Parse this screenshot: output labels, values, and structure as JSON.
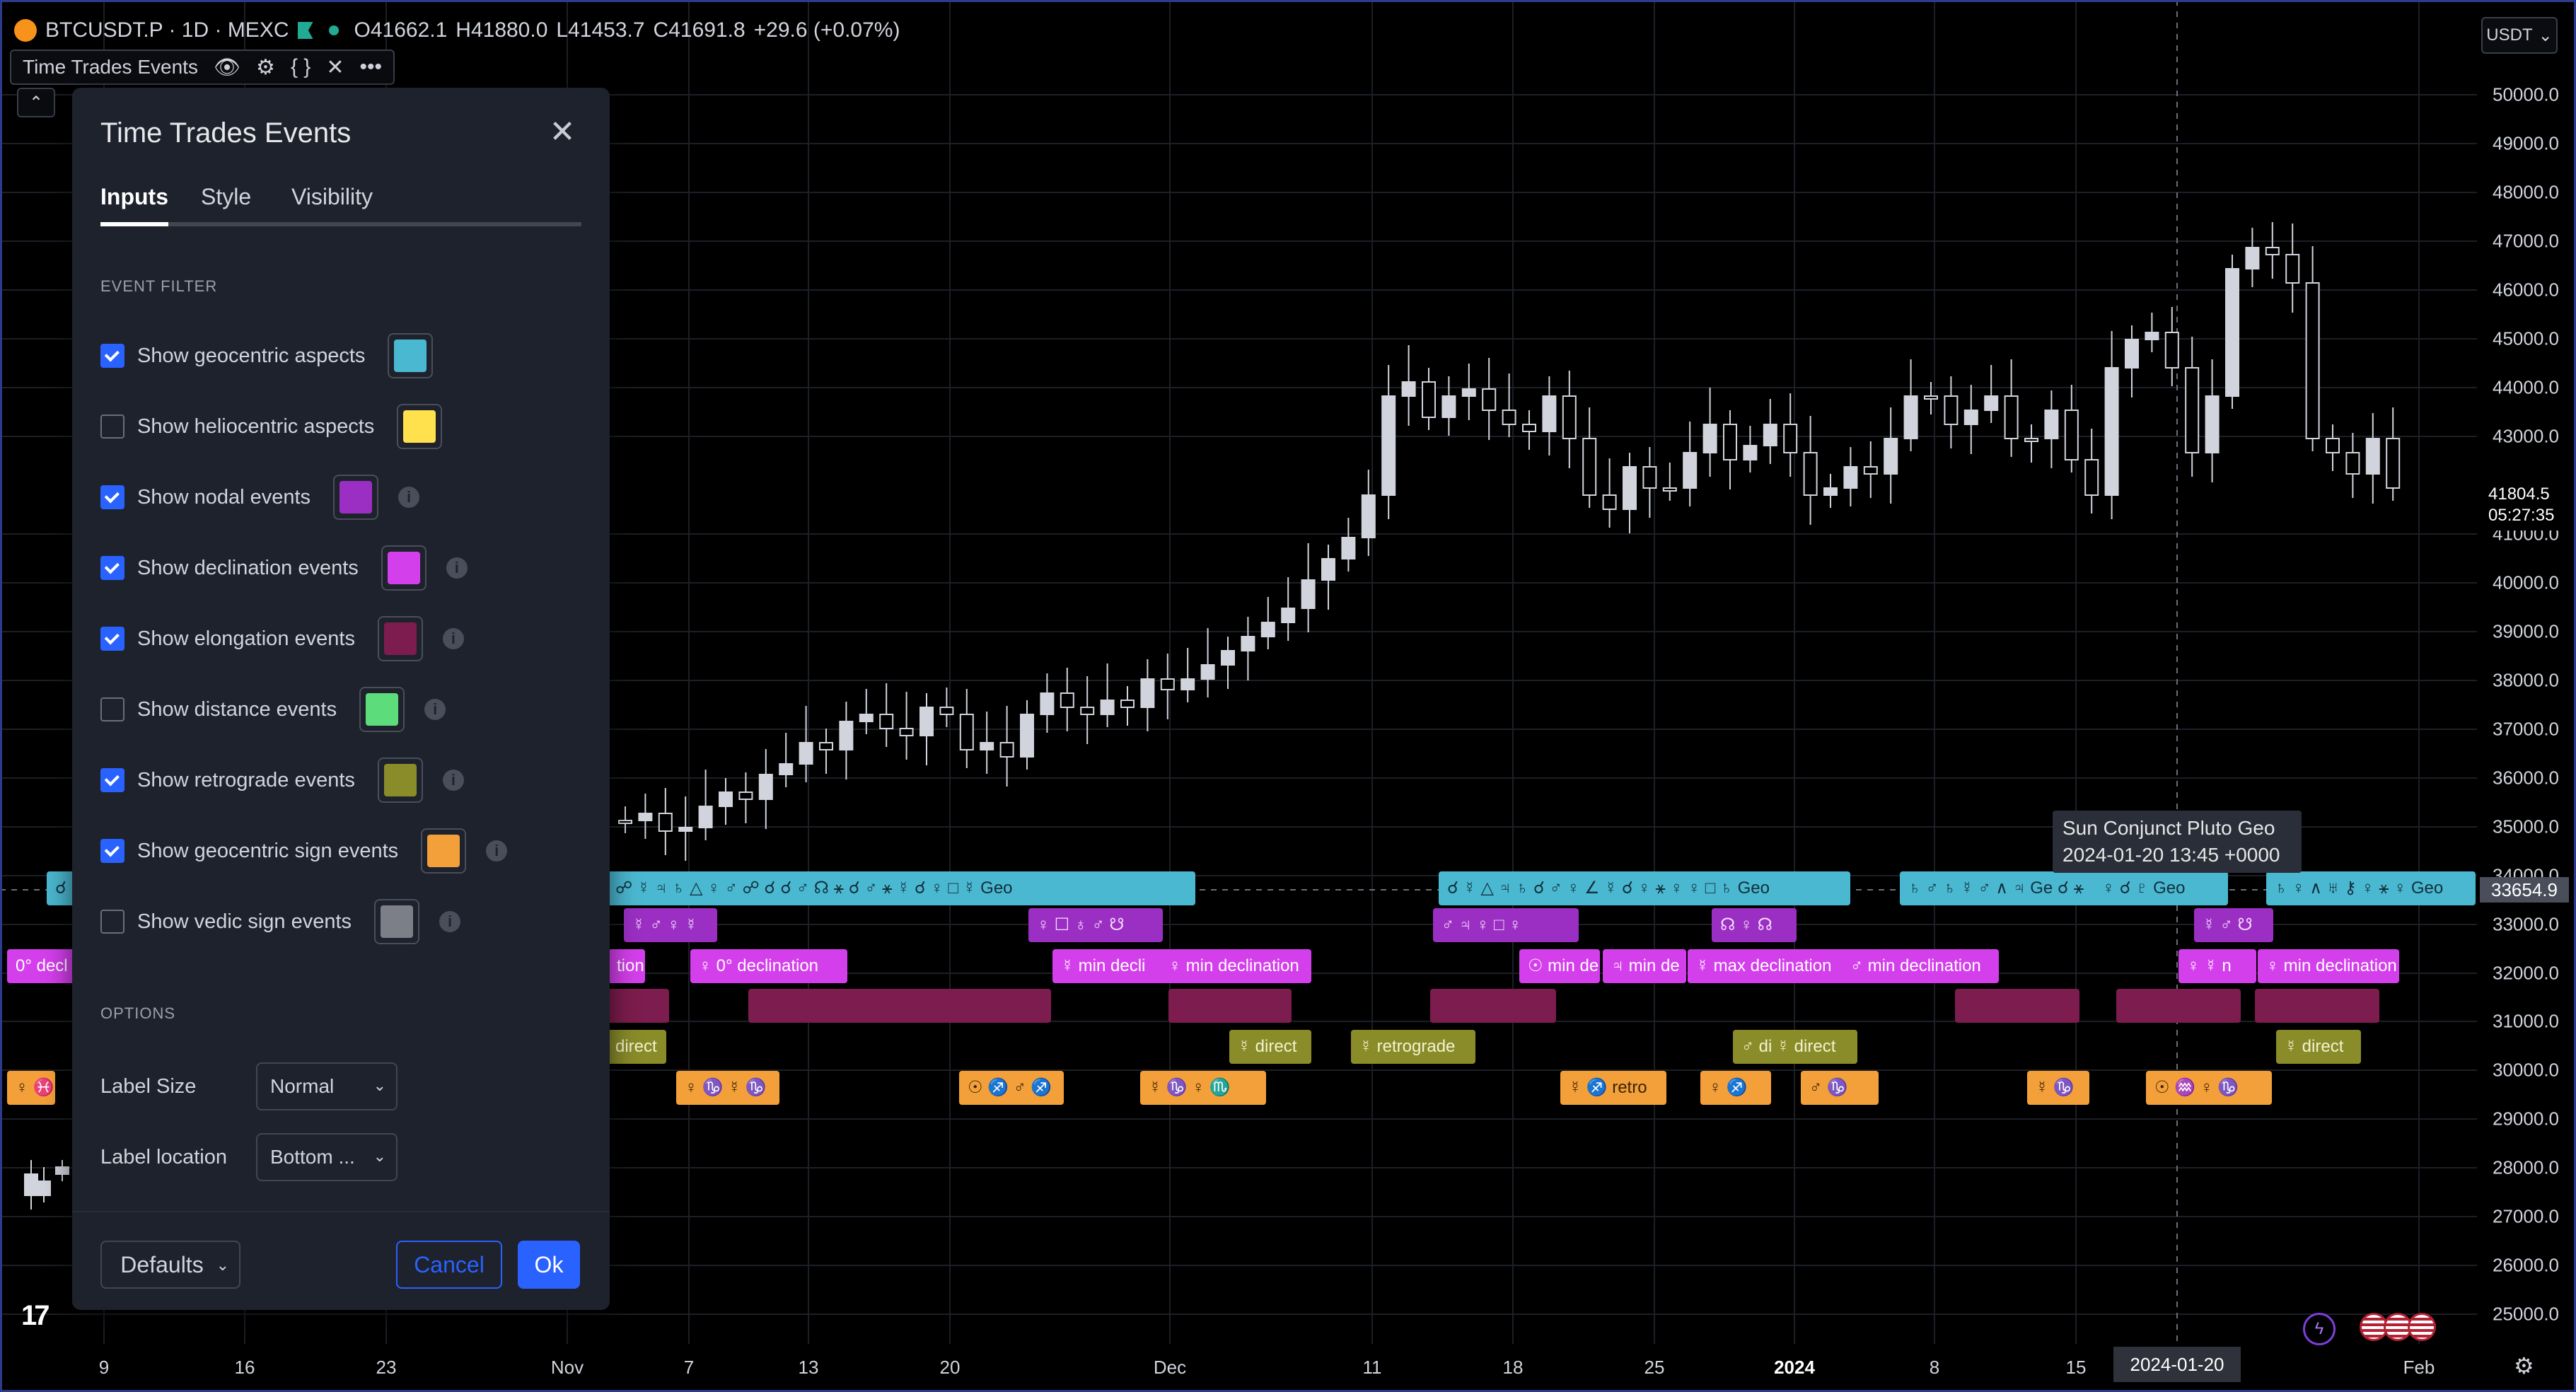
{
  "header": {
    "symbol": "BTCUSDT.P · 1D · MEXC",
    "open": "O41662.1",
    "high": "H41880.0",
    "low": "L41453.7",
    "close": "C41691.8",
    "change": "+29.6 (+0.07%)"
  },
  "indicator": {
    "name": "Time Trades Events"
  },
  "price_axis": {
    "currency": "USDT",
    "ticks": [
      "50000.0",
      "49000.0",
      "48000.0",
      "47000.0",
      "46000.0",
      "45000.0",
      "44000.0",
      "43000.0",
      "41000.0",
      "40000.0",
      "39000.0",
      "38000.0",
      "37000.0",
      "36000.0",
      "35000.0",
      "34000.0",
      "33000.0",
      "32000.0",
      "31000.0",
      "30000.0",
      "29000.0",
      "28000.0",
      "27000.0",
      "26000.0",
      "25000.0"
    ],
    "last_price": "41804.5",
    "countdown": "05:27:35",
    "crosshair_price": "33654.9"
  },
  "time_axis": {
    "labels": [
      "9",
      "16",
      "23",
      "Nov",
      "7",
      "13",
      "20",
      "Dec",
      "11",
      "18",
      "25",
      "2024",
      "8",
      "15",
      "Feb"
    ],
    "crosshair_date": "2024-01-20"
  },
  "tooltip": {
    "line1": "Sun Conjunct Pluto Geo",
    "line2": "2024-01-20 13:45 +0000"
  },
  "events": [
    {
      "cls": "ev-geo",
      "text": "☌"
    },
    {
      "cls": "ev-geo",
      "text": "☍ ☿ ♃ ♄ △ ♀ ♂ ☍ ☌ ☌ ♂ ☊ ⚹ ☌ ♂ ⚹ ☿ ☌ ♀ □ ☿ Geo"
    },
    {
      "cls": "ev-geo",
      "text": "♀ ☐ ♀ ♄ ☿ △ ♀ ⚹ ♀ Geo"
    },
    {
      "cls": "ev-geo",
      "text": "☌ ☿ △ ♃ ♄ ☌ ♂ ♀ ∠ ☿ ☌ ♀ ⚹ ♀ ♀ □ ♄ Geo"
    },
    {
      "cls": "ev-geo",
      "text": "♄ ♂ ♄ ☿ ♂ ∧ ♃ Ge ☌ ⚹"
    },
    {
      "cls": "ev-geo",
      "text": "♀ ☌ ♇ Geo"
    },
    {
      "cls": "ev-geo",
      "text": "♄ ♀ ∧ ♅ ⚷ ♀ ⚹ ♀ Geo"
    },
    {
      "cls": "ev-node",
      "text": "☿ ♂ ♀ ☿"
    },
    {
      "cls": "ev-node",
      "text": "♀ ☐ ♁ ♂ ☋"
    },
    {
      "cls": "ev-node",
      "text": "♂ ♃ ♀ □ ♀"
    },
    {
      "cls": "ev-node",
      "text": "☊ ♀ ☊"
    },
    {
      "cls": "ev-node",
      "text": "☿ ♂ ☋"
    },
    {
      "cls": "ev-decl",
      "text": "0° decl"
    },
    {
      "cls": "ev-decl",
      "text": "tion"
    },
    {
      "cls": "ev-decl",
      "text": "♀ 0° declination"
    },
    {
      "cls": "ev-decl",
      "text": "☿ min decli"
    },
    {
      "cls": "ev-decl",
      "text": "♀ min declination"
    },
    {
      "cls": "ev-decl",
      "text": "☉ min de"
    },
    {
      "cls": "ev-decl",
      "text": "♃ min de"
    },
    {
      "cls": "ev-decl",
      "text": "☿ max declination"
    },
    {
      "cls": "ev-decl",
      "text": "♂ min declination"
    },
    {
      "cls": "ev-decl",
      "text": "♀ ☿ n"
    },
    {
      "cls": "ev-decl",
      "text": "♀ min declination"
    },
    {
      "cls": "ev-elong",
      "text": ""
    },
    {
      "cls": "ev-elong",
      "text": ""
    },
    {
      "cls": "ev-elong",
      "text": ""
    },
    {
      "cls": "ev-elong",
      "text": ""
    },
    {
      "cls": "ev-elong",
      "text": ""
    },
    {
      "cls": "ev-elong",
      "text": ""
    },
    {
      "cls": "ev-elong",
      "text": ""
    },
    {
      "cls": "ev-retro",
      "text": "direct"
    },
    {
      "cls": "ev-retro",
      "text": "☿ direct"
    },
    {
      "cls": "ev-retro",
      "text": "☿ retrograde"
    },
    {
      "cls": "ev-retro",
      "text": "♂ di ☿ direct"
    },
    {
      "cls": "ev-retro",
      "text": "☿ direct"
    },
    {
      "cls": "ev-sign",
      "text": "♀ ♓"
    },
    {
      "cls": "ev-sign",
      "text": "♀ ♑ ☿ ♑"
    },
    {
      "cls": "ev-sign",
      "text": "☉ ♐ ♂ ♐"
    },
    {
      "cls": "ev-sign",
      "text": "☿ ♑ ♀ ♏"
    },
    {
      "cls": "ev-sign",
      "text": "☿ ♐ retro"
    },
    {
      "cls": "ev-sign",
      "text": "♀ ♐"
    },
    {
      "cls": "ev-sign",
      "text": "♂ ♑"
    },
    {
      "cls": "ev-sign",
      "text": "☿ ♑"
    },
    {
      "cls": "ev-sign",
      "text": "☉ ♒ ♀ ♑"
    }
  ],
  "dialog": {
    "title": "Time Trades Events",
    "tabs": [
      "Inputs",
      "Style",
      "Visibility"
    ],
    "section_event_filter": "EVENT FILTER",
    "rows": [
      {
        "label": "Show geocentric aspects",
        "checked": true,
        "color": "#4bb8d1",
        "info": false
      },
      {
        "label": "Show heliocentric aspects",
        "checked": false,
        "color": "#ffe14d",
        "info": false
      },
      {
        "label": "Show nodal events",
        "checked": true,
        "color": "#9b2fc3",
        "info": true
      },
      {
        "label": "Show declination events",
        "checked": true,
        "color": "#d43fec",
        "info": true
      },
      {
        "label": "Show elongation events",
        "checked": true,
        "color": "#7d1c4e",
        "info": true
      },
      {
        "label": "Show distance events",
        "checked": false,
        "color": "#5ddc7b",
        "info": true
      },
      {
        "label": "Show retrograde events",
        "checked": true,
        "color": "#8a8c2a",
        "info": true
      },
      {
        "label": "Show geocentric sign events",
        "checked": true,
        "color": "#f4a03a",
        "info": true
      },
      {
        "label": "Show vedic sign events",
        "checked": false,
        "color": "#7c7f88",
        "info": true
      }
    ],
    "section_options": "OPTIONS",
    "label_size_label": "Label Size",
    "label_size_value": "Normal",
    "label_location_label": "Label location",
    "label_location_value": "Bottom ...",
    "defaults": "Defaults",
    "cancel": "Cancel",
    "ok": "Ok"
  }
}
